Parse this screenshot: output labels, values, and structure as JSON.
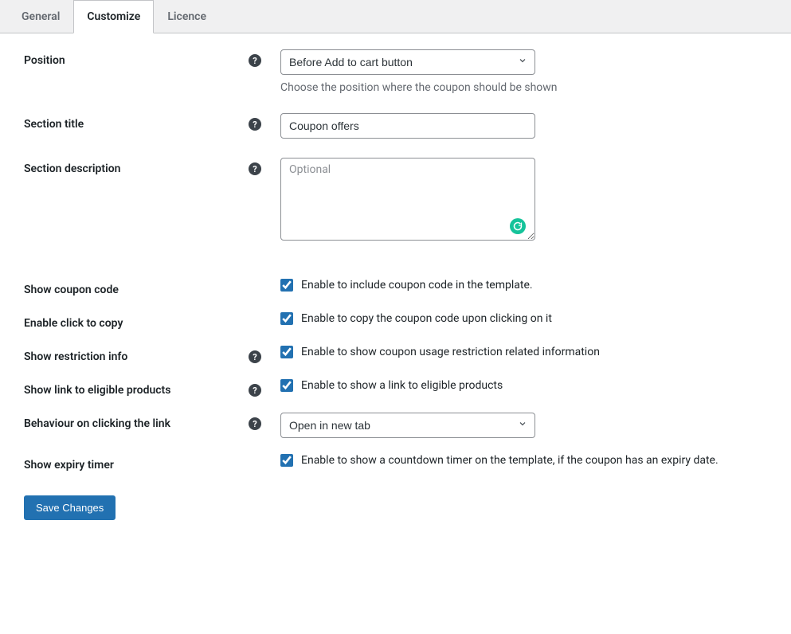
{
  "tabs": {
    "general": "General",
    "customize": "Customize",
    "licence": "Licence"
  },
  "fields": {
    "position": {
      "label": "Position",
      "selected": "Before Add to cart button",
      "helper": "Choose the position where the coupon should be shown"
    },
    "section_title": {
      "label": "Section title",
      "value": "Coupon offers"
    },
    "section_description": {
      "label": "Section description",
      "placeholder": "Optional"
    },
    "show_coupon_code": {
      "label": "Show coupon code",
      "desc": "Enable to include coupon code in the template."
    },
    "enable_click_to_copy": {
      "label": "Enable click to copy",
      "desc": "Enable to copy the coupon code upon clicking on it"
    },
    "show_restriction_info": {
      "label": "Show restriction info",
      "desc": "Enable to show coupon usage restriction related information"
    },
    "show_link_eligible": {
      "label": "Show link to eligible products",
      "desc": "Enable to show a link to eligible products"
    },
    "behaviour_link": {
      "label": "Behaviour on clicking the link",
      "selected": "Open in new tab"
    },
    "show_expiry_timer": {
      "label": "Show expiry timer",
      "desc": "Enable to show a countdown timer on the template, if the coupon has an expiry date."
    }
  },
  "buttons": {
    "save": "Save Changes"
  }
}
